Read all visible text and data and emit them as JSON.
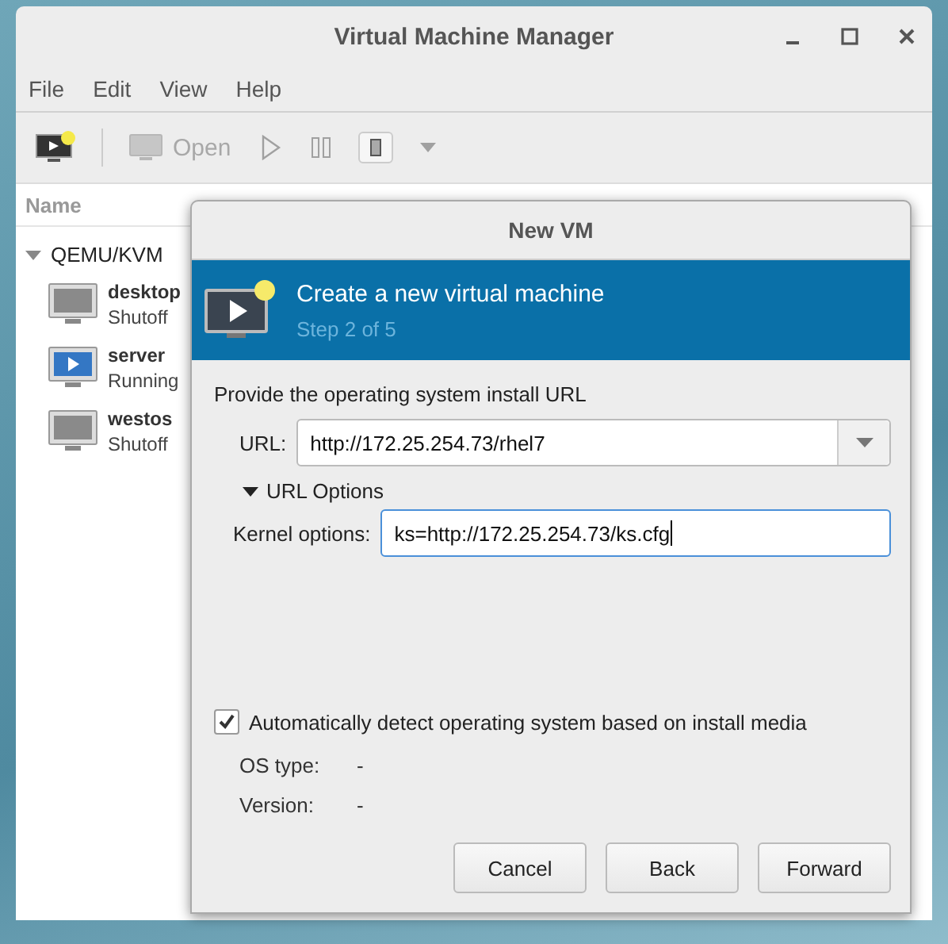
{
  "window": {
    "title": "Virtual Machine Manager"
  },
  "menu": [
    "File",
    "Edit",
    "View",
    "Help"
  ],
  "toolbar": [
    {
      "kind": "new",
      "disabled": false
    },
    {
      "kind": "open",
      "label": "Open",
      "disabled": true
    },
    {
      "kind": "run",
      "disabled": true
    },
    {
      "kind": "pause",
      "disabled": true
    },
    {
      "kind": "shutdown",
      "disabled": false
    },
    {
      "kind": "dropdown",
      "disabled": true
    }
  ],
  "list": {
    "column": "Name",
    "group": {
      "label": "QEMU/KVM",
      "expanded": true,
      "children": [
        {
          "name": "desktop",
          "status": "Shutoff",
          "running": false
        },
        {
          "name": "server",
          "status": "Running",
          "running": true
        },
        {
          "name": "westos",
          "status": "Shutoff",
          "running": false
        }
      ]
    }
  },
  "dialog": {
    "title": "New VM",
    "heading": "Create a new virtual machine",
    "step": "Step 2 of 5",
    "prompt": "Provide the operating system install URL",
    "url": {
      "label": "URL:",
      "value": "http://172.25.254.73/rhel7"
    },
    "options": {
      "label": "URL Options",
      "expanded": true
    },
    "kernel": {
      "label": "Kernel options:",
      "value": "ks=http://172.25.254.73/ks.cfg",
      "focused": true
    },
    "autodetect": {
      "label": "Automatically detect operating system based on install media",
      "checked": true
    },
    "details": [
      {
        "label": "OS type:",
        "value": "-"
      },
      {
        "label": "Version:",
        "value": "-"
      }
    ],
    "buttons": [
      "Cancel",
      "Back",
      "Forward"
    ]
  }
}
